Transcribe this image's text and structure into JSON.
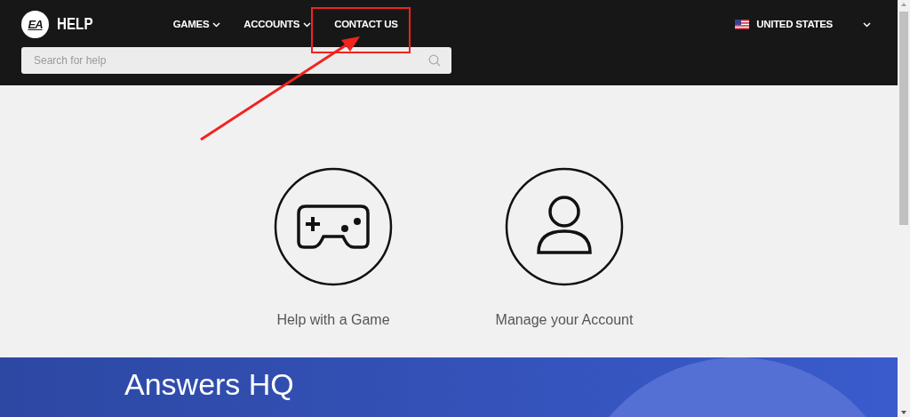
{
  "header": {
    "logo": "EA",
    "brand": "HELP",
    "nav": [
      {
        "label": "GAMES",
        "dropdown": true
      },
      {
        "label": "ACCOUNTS",
        "dropdown": true
      },
      {
        "label": "CONTACT US",
        "dropdown": false
      }
    ],
    "search": {
      "placeholder": "Search for help"
    },
    "region": {
      "label": "UNITED STATES",
      "dropdown": true
    }
  },
  "tiles": [
    {
      "kind": "gamepad",
      "label": "Help with a Game"
    },
    {
      "kind": "person",
      "label": "Manage your Account"
    }
  ],
  "banner": {
    "title": "Answers HQ"
  },
  "annotations": {
    "highlight_box": true,
    "arrow": true
  }
}
